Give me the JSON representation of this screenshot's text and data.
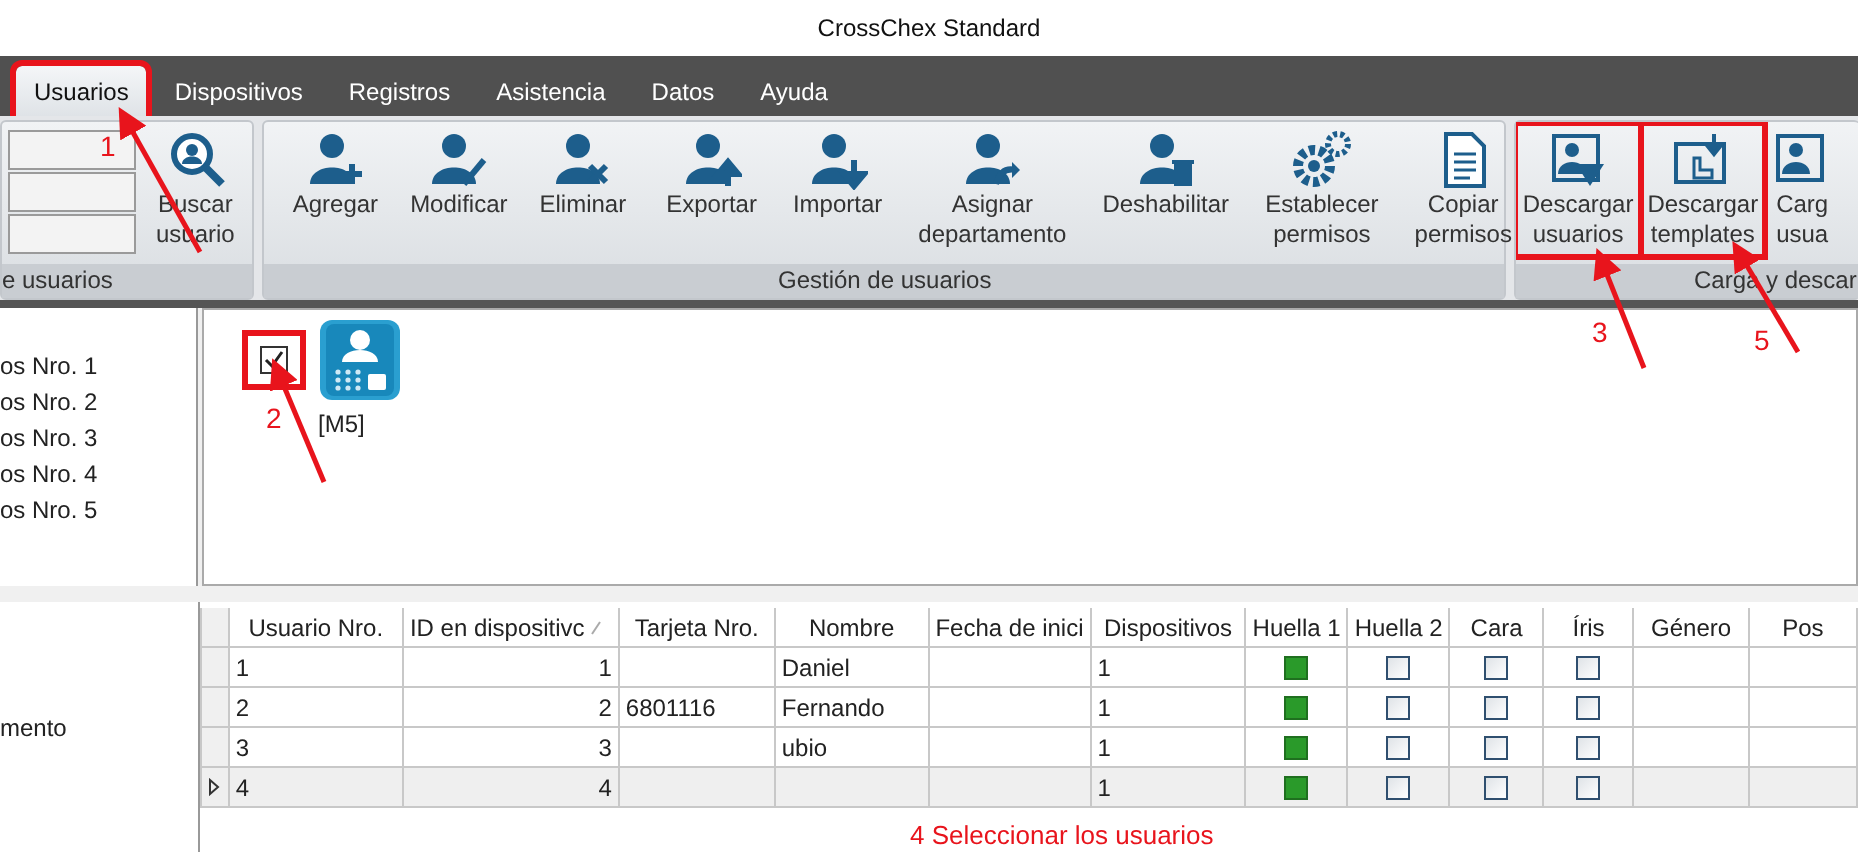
{
  "window": {
    "title": "CrossChex Standard"
  },
  "menu_tabs": [
    {
      "label": "Usuarios",
      "selected": true,
      "highlighted": true
    },
    {
      "label": "Dispositivos",
      "selected": false,
      "highlighted": false
    },
    {
      "label": "Registros",
      "selected": false,
      "highlighted": false
    },
    {
      "label": "Asistencia",
      "selected": false,
      "highlighted": false
    },
    {
      "label": "Datos",
      "selected": false,
      "highlighted": false
    },
    {
      "label": "Ayuda",
      "selected": false,
      "highlighted": false
    }
  ],
  "ribbon": {
    "groups": [
      {
        "label": "e usuarios",
        "kind": "search",
        "sets": [
          [
            {
              "label": "Buscar usuario",
              "highlighted": false
            }
          ]
        ]
      },
      {
        "label": "Gestión de usuarios",
        "kind": "plain",
        "sets": [
          [
            {
              "label": "Agregar",
              "highlighted": false
            },
            {
              "label": "Modificar",
              "highlighted": false
            },
            {
              "label": "Eliminar",
              "highlighted": false
            }
          ],
          [
            {
              "label": "Exportar",
              "highlighted": false
            },
            {
              "label": "Importar",
              "highlighted": false
            },
            {
              "label": "Asignar departamento",
              "highlighted": false
            },
            {
              "label": "Deshabilitar",
              "highlighted": false
            },
            {
              "label": "Establecer permisos",
              "highlighted": false
            },
            {
              "label": "Copiar permisos",
              "highlighted": false
            }
          ]
        ]
      },
      {
        "label": "Carga y descar",
        "kind": "cut",
        "sets": [
          [
            {
              "label": "Descargar usuarios",
              "highlighted": true
            },
            {
              "label": "Descargar templates",
              "highlighted": true
            },
            {
              "label": "Carg usua",
              "highlighted": false
            }
          ]
        ]
      }
    ]
  },
  "department_list": {
    "items": [
      "os Nro. 1",
      "os Nro. 2",
      "os Nro. 3",
      "os Nro. 4",
      "os Nro. 5"
    ]
  },
  "devices": [
    {
      "label": "[M5]",
      "checked": true,
      "highlighted": true
    }
  ],
  "side_panel": {
    "text": "mento"
  },
  "table": {
    "columns": [
      {
        "label": "Usuario Nro.",
        "kind": "text",
        "sorted": false
      },
      {
        "label": "ID en dispositivc",
        "kind": "number",
        "sorted": true
      },
      {
        "label": "Tarjeta Nro.",
        "kind": "text",
        "sorted": false
      },
      {
        "label": "Nombre",
        "kind": "text",
        "sorted": false
      },
      {
        "label": "Fecha de inici",
        "kind": "text",
        "sorted": false
      },
      {
        "label": "Dispositivos",
        "kind": "text",
        "sorted": false
      },
      {
        "label": "Huella 1",
        "kind": "check",
        "sorted": false
      },
      {
        "label": "Huella 2",
        "kind": "check",
        "sorted": false
      },
      {
        "label": "Cara",
        "kind": "check",
        "sorted": false
      },
      {
        "label": "Íris",
        "kind": "check",
        "sorted": false
      },
      {
        "label": "Género",
        "kind": "text",
        "sorted": false
      },
      {
        "label": "Pos",
        "kind": "text",
        "sorted": false
      }
    ],
    "rows": [
      {
        "current": false,
        "cells": [
          "1",
          "1",
          null,
          "Daniel",
          null,
          "1",
          true,
          false,
          false,
          false,
          null,
          null
        ]
      },
      {
        "current": false,
        "cells": [
          "2",
          "2",
          "6801116",
          "Fernando",
          null,
          "1",
          true,
          false,
          false,
          false,
          null,
          null
        ]
      },
      {
        "current": false,
        "cells": [
          "3",
          "3",
          null,
          "ubio",
          null,
          "1",
          true,
          false,
          false,
          false,
          null,
          null
        ]
      },
      {
        "current": true,
        "cells": [
          "4",
          "4",
          null,
          null,
          null,
          "1",
          true,
          false,
          false,
          false,
          null,
          null
        ]
      }
    ]
  },
  "callouts": [
    {
      "label": "1"
    },
    {
      "label": "2"
    },
    {
      "label": "3"
    },
    {
      "label": "5"
    }
  ],
  "note": "4 Seleccionar los usuarios"
}
